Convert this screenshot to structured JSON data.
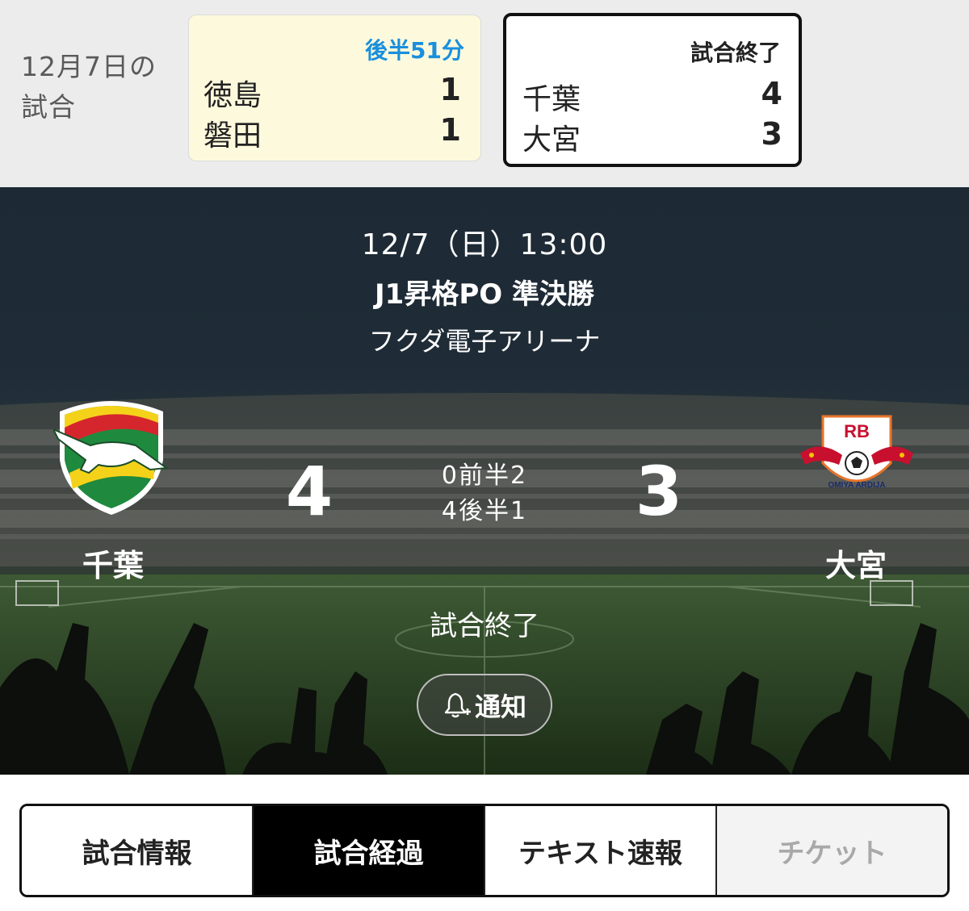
{
  "day_label": "12月7日の試合",
  "mini_cards": [
    {
      "status": "後半51分",
      "status_color": "#1a8fdd",
      "background": "#fdf9dc",
      "home": {
        "name": "徳島",
        "score": "1"
      },
      "away": {
        "name": "磐田",
        "score": "1"
      }
    },
    {
      "status": "試合終了",
      "status_color": "#222222",
      "background": "#ffffff",
      "home": {
        "name": "千葉",
        "score": "4"
      },
      "away": {
        "name": "大宮",
        "score": "3"
      }
    }
  ],
  "match": {
    "datetime": "12/7（日）13:00",
    "competition": "J1昇格PO 準決勝",
    "venue": "フクダ電子アリーナ",
    "home": {
      "name": "千葉",
      "score": "4",
      "crest_icon": "jef-united-crest-icon"
    },
    "away": {
      "name": "大宮",
      "score": "3",
      "crest_icon": "rb-omiya-ardija-crest-icon"
    },
    "first_half": {
      "home": "0",
      "label": "前半",
      "away": "2"
    },
    "second_half": {
      "home": "4",
      "label": "後半",
      "away": "1"
    },
    "status": "試合終了",
    "notify_label": "通知",
    "away_crest_text": {
      "top": "RB",
      "bottom": "OMIYA ARDIJA"
    }
  },
  "tabs": [
    {
      "label": "試合情報",
      "state": "normal"
    },
    {
      "label": "試合経過",
      "state": "active"
    },
    {
      "label": "テキスト速報",
      "state": "normal"
    },
    {
      "label": "チケット",
      "state": "disabled"
    }
  ],
  "colors": {
    "accent_blue": "#1a8fdd",
    "tab_active": "#000000",
    "hero_text": "#ffffff"
  }
}
